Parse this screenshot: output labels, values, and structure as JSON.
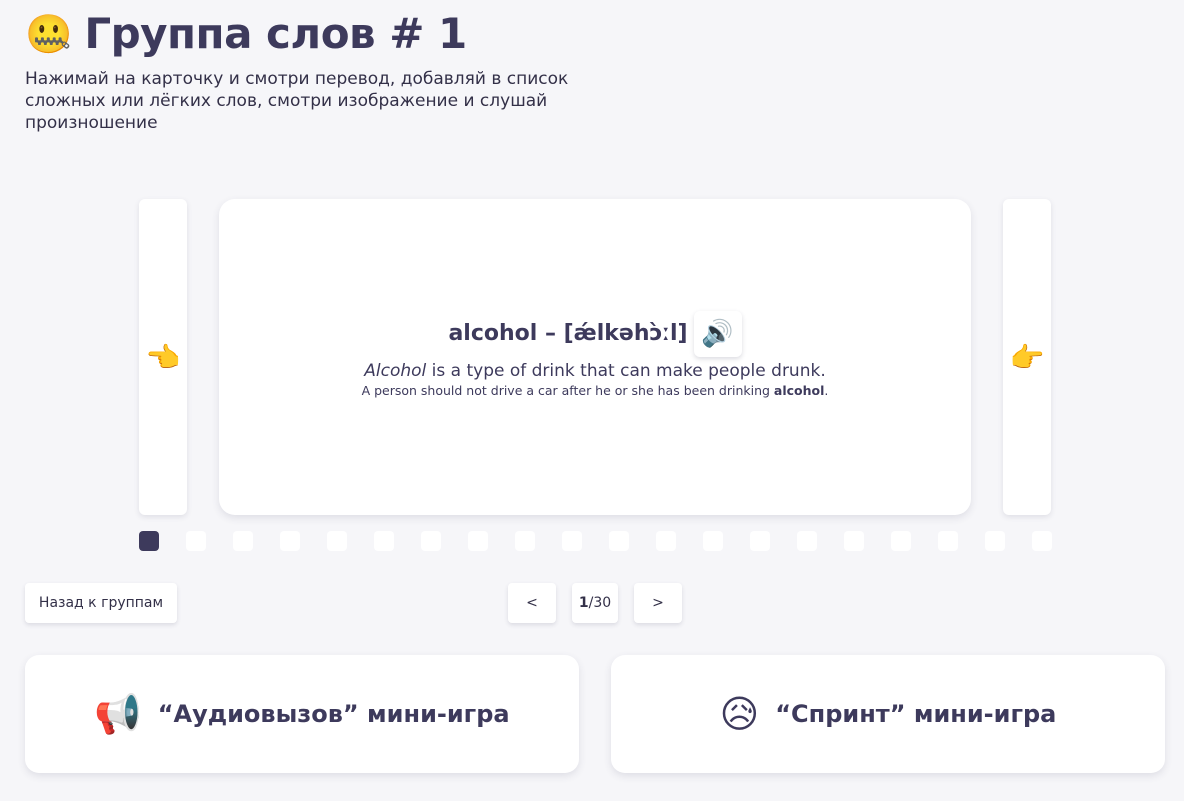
{
  "header": {
    "emoji": "🤐",
    "title": "Группа слов # 1",
    "subtitle": "Нажимай на карточку и смотри перевод, добавляй в список сложных или лёгких слов, смотри изображение и слушай произношение"
  },
  "slider": {
    "prev_emoji": "👈",
    "next_emoji": "👉",
    "card": {
      "word": "alcohol – [ǽlkəhɔ̀ːl]",
      "sound_emoji": "🔊",
      "meaning_word": "Alcohol",
      "meaning_rest": " is a type of drink that can make people drunk.",
      "example_before": "A person should not drive a car after he or she has been drinking ",
      "example_word": "alcohol",
      "example_after": "."
    },
    "dots_count": 20,
    "active_dot": 0
  },
  "nav": {
    "back_label": "Назад к группам",
    "prev_label": "<",
    "next_label": ">",
    "current_page": "1",
    "page_separator": " / ",
    "total_pages": "30"
  },
  "games": [
    {
      "emoji": "📢",
      "label": "“Аудиовызов” мини-игра"
    },
    {
      "emoji": "😥",
      "label": "“Спринт” мини-игра"
    }
  ],
  "colors": {
    "accent": "#3d3a5c",
    "background": "#f6f6f9",
    "card": "#ffffff"
  }
}
